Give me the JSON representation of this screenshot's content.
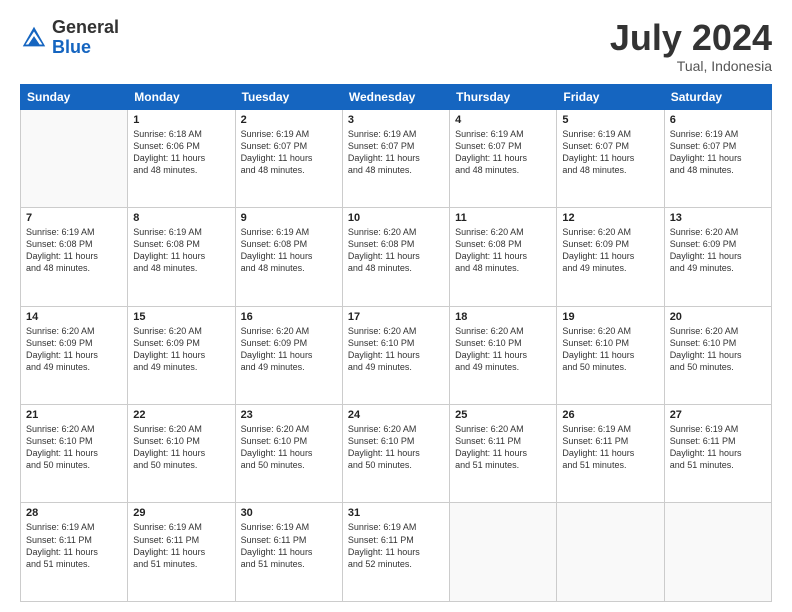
{
  "header": {
    "logo_general": "General",
    "logo_blue": "Blue",
    "month_title": "July 2024",
    "location": "Tual, Indonesia"
  },
  "days_of_week": [
    "Sunday",
    "Monday",
    "Tuesday",
    "Wednesday",
    "Thursday",
    "Friday",
    "Saturday"
  ],
  "weeks": [
    [
      {
        "day": "",
        "sunrise": "",
        "sunset": "",
        "daylight": ""
      },
      {
        "day": "1",
        "sunrise": "6:18 AM",
        "sunset": "6:06 PM",
        "hours": "11 hours",
        "minutes": "and 48 minutes."
      },
      {
        "day": "2",
        "sunrise": "6:19 AM",
        "sunset": "6:07 PM",
        "hours": "11 hours",
        "minutes": "and 48 minutes."
      },
      {
        "day": "3",
        "sunrise": "6:19 AM",
        "sunset": "6:07 PM",
        "hours": "11 hours",
        "minutes": "and 48 minutes."
      },
      {
        "day": "4",
        "sunrise": "6:19 AM",
        "sunset": "6:07 PM",
        "hours": "11 hours",
        "minutes": "and 48 minutes."
      },
      {
        "day": "5",
        "sunrise": "6:19 AM",
        "sunset": "6:07 PM",
        "hours": "11 hours",
        "minutes": "and 48 minutes."
      },
      {
        "day": "6",
        "sunrise": "6:19 AM",
        "sunset": "6:07 PM",
        "hours": "11 hours",
        "minutes": "and 48 minutes."
      }
    ],
    [
      {
        "day": "7",
        "sunrise": "6:19 AM",
        "sunset": "6:08 PM",
        "hours": "11 hours",
        "minutes": "and 48 minutes."
      },
      {
        "day": "8",
        "sunrise": "6:19 AM",
        "sunset": "6:08 PM",
        "hours": "11 hours",
        "minutes": "and 48 minutes."
      },
      {
        "day": "9",
        "sunrise": "6:19 AM",
        "sunset": "6:08 PM",
        "hours": "11 hours",
        "minutes": "and 48 minutes."
      },
      {
        "day": "10",
        "sunrise": "6:20 AM",
        "sunset": "6:08 PM",
        "hours": "11 hours",
        "minutes": "and 48 minutes."
      },
      {
        "day": "11",
        "sunrise": "6:20 AM",
        "sunset": "6:08 PM",
        "hours": "11 hours",
        "minutes": "and 48 minutes."
      },
      {
        "day": "12",
        "sunrise": "6:20 AM",
        "sunset": "6:09 PM",
        "hours": "11 hours",
        "minutes": "and 49 minutes."
      },
      {
        "day": "13",
        "sunrise": "6:20 AM",
        "sunset": "6:09 PM",
        "hours": "11 hours",
        "minutes": "and 49 minutes."
      }
    ],
    [
      {
        "day": "14",
        "sunrise": "6:20 AM",
        "sunset": "6:09 PM",
        "hours": "11 hours",
        "minutes": "and 49 minutes."
      },
      {
        "day": "15",
        "sunrise": "6:20 AM",
        "sunset": "6:09 PM",
        "hours": "11 hours",
        "minutes": "and 49 minutes."
      },
      {
        "day": "16",
        "sunrise": "6:20 AM",
        "sunset": "6:09 PM",
        "hours": "11 hours",
        "minutes": "and 49 minutes."
      },
      {
        "day": "17",
        "sunrise": "6:20 AM",
        "sunset": "6:10 PM",
        "hours": "11 hours",
        "minutes": "and 49 minutes."
      },
      {
        "day": "18",
        "sunrise": "6:20 AM",
        "sunset": "6:10 PM",
        "hours": "11 hours",
        "minutes": "and 49 minutes."
      },
      {
        "day": "19",
        "sunrise": "6:20 AM",
        "sunset": "6:10 PM",
        "hours": "11 hours",
        "minutes": "and 50 minutes."
      },
      {
        "day": "20",
        "sunrise": "6:20 AM",
        "sunset": "6:10 PM",
        "hours": "11 hours",
        "minutes": "and 50 minutes."
      }
    ],
    [
      {
        "day": "21",
        "sunrise": "6:20 AM",
        "sunset": "6:10 PM",
        "hours": "11 hours",
        "minutes": "and 50 minutes."
      },
      {
        "day": "22",
        "sunrise": "6:20 AM",
        "sunset": "6:10 PM",
        "hours": "11 hours",
        "minutes": "and 50 minutes."
      },
      {
        "day": "23",
        "sunrise": "6:20 AM",
        "sunset": "6:10 PM",
        "hours": "11 hours",
        "minutes": "and 50 minutes."
      },
      {
        "day": "24",
        "sunrise": "6:20 AM",
        "sunset": "6:10 PM",
        "hours": "11 hours",
        "minutes": "and 50 minutes."
      },
      {
        "day": "25",
        "sunrise": "6:20 AM",
        "sunset": "6:11 PM",
        "hours": "11 hours",
        "minutes": "and 51 minutes."
      },
      {
        "day": "26",
        "sunrise": "6:19 AM",
        "sunset": "6:11 PM",
        "hours": "11 hours",
        "minutes": "and 51 minutes."
      },
      {
        "day": "27",
        "sunrise": "6:19 AM",
        "sunset": "6:11 PM",
        "hours": "11 hours",
        "minutes": "and 51 minutes."
      }
    ],
    [
      {
        "day": "28",
        "sunrise": "6:19 AM",
        "sunset": "6:11 PM",
        "hours": "11 hours",
        "minutes": "and 51 minutes."
      },
      {
        "day": "29",
        "sunrise": "6:19 AM",
        "sunset": "6:11 PM",
        "hours": "11 hours",
        "minutes": "and 51 minutes."
      },
      {
        "day": "30",
        "sunrise": "6:19 AM",
        "sunset": "6:11 PM",
        "hours": "11 hours",
        "minutes": "and 51 minutes."
      },
      {
        "day": "31",
        "sunrise": "6:19 AM",
        "sunset": "6:11 PM",
        "hours": "11 hours",
        "minutes": "and 52 minutes."
      },
      {
        "day": "",
        "sunrise": "",
        "sunset": "",
        "hours": "",
        "minutes": ""
      },
      {
        "day": "",
        "sunrise": "",
        "sunset": "",
        "hours": "",
        "minutes": ""
      },
      {
        "day": "",
        "sunrise": "",
        "sunset": "",
        "hours": "",
        "minutes": ""
      }
    ]
  ]
}
